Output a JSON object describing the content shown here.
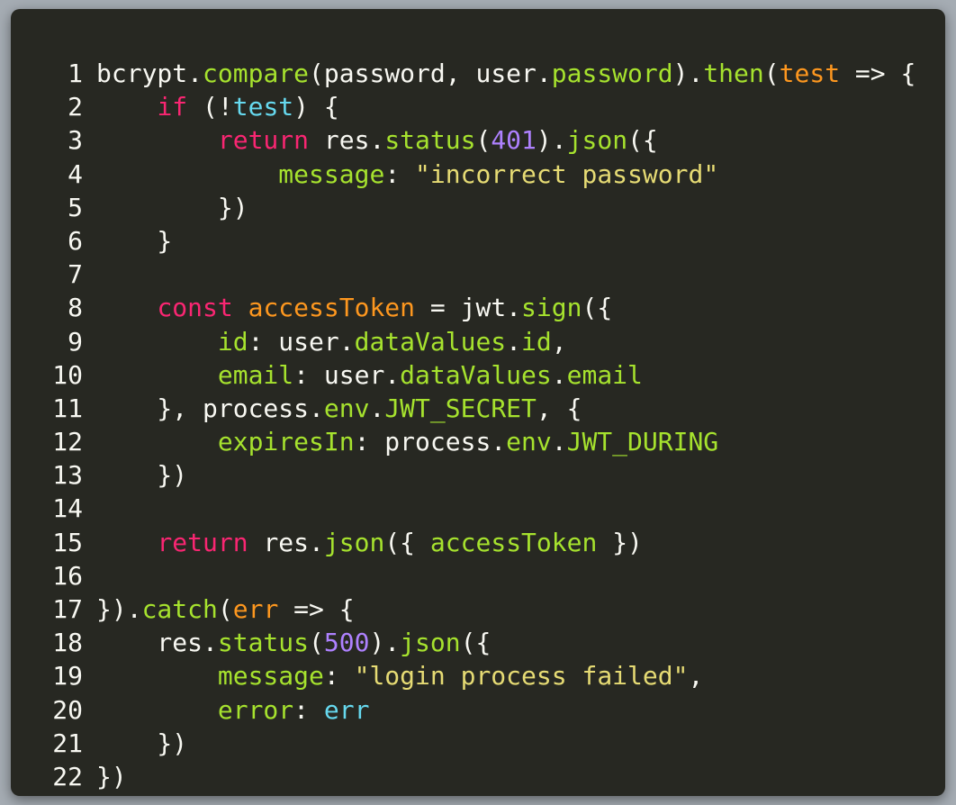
{
  "colors": {
    "default": "#f8f8f2",
    "keyword": "#f92672",
    "function": "#a6e22e",
    "param": "#fd971f",
    "number": "#ae81ff",
    "string": "#e6db74",
    "builtin": "#66d9ef",
    "background": "#272822"
  },
  "code": {
    "language": "javascript",
    "lines": [
      {
        "n": "1",
        "tokens": [
          [
            "bcrypt.",
            "d"
          ],
          [
            "compare",
            "f"
          ],
          [
            "(password, user.",
            "d"
          ],
          [
            "password",
            "f"
          ],
          [
            ").",
            "d"
          ],
          [
            "then",
            "f"
          ],
          [
            "(",
            "d"
          ],
          [
            "test",
            "p"
          ],
          [
            " => {",
            "d"
          ]
        ]
      },
      {
        "n": "2",
        "tokens": [
          [
            "    ",
            "d"
          ],
          [
            "if",
            "k"
          ],
          [
            " (!",
            "d"
          ],
          [
            "test",
            "b"
          ],
          [
            ") {",
            "d"
          ]
        ]
      },
      {
        "n": "3",
        "tokens": [
          [
            "        ",
            "d"
          ],
          [
            "return",
            "k"
          ],
          [
            " res.",
            "d"
          ],
          [
            "status",
            "f"
          ],
          [
            "(",
            "d"
          ],
          [
            "401",
            "n"
          ],
          [
            ").",
            "d"
          ],
          [
            "json",
            "f"
          ],
          [
            "({",
            "d"
          ]
        ]
      },
      {
        "n": "4",
        "tokens": [
          [
            "            ",
            "d"
          ],
          [
            "message",
            "f"
          ],
          [
            ": ",
            "d"
          ],
          [
            "\"incorrect password\"",
            "s"
          ]
        ]
      },
      {
        "n": "5",
        "tokens": [
          [
            "        })",
            "d"
          ]
        ]
      },
      {
        "n": "6",
        "tokens": [
          [
            "    }",
            "d"
          ]
        ]
      },
      {
        "n": "7",
        "tokens": []
      },
      {
        "n": "8",
        "tokens": [
          [
            "    ",
            "d"
          ],
          [
            "const",
            "k"
          ],
          [
            " ",
            "d"
          ],
          [
            "accessToken",
            "p"
          ],
          [
            " = jwt.",
            "d"
          ],
          [
            "sign",
            "f"
          ],
          [
            "({",
            "d"
          ]
        ]
      },
      {
        "n": "9",
        "tokens": [
          [
            "        ",
            "d"
          ],
          [
            "id",
            "f"
          ],
          [
            ": user.",
            "d"
          ],
          [
            "dataValues",
            "f"
          ],
          [
            ".",
            "d"
          ],
          [
            "id",
            "f"
          ],
          [
            ",",
            "d"
          ]
        ]
      },
      {
        "n": "10",
        "tokens": [
          [
            "        ",
            "d"
          ],
          [
            "email",
            "f"
          ],
          [
            ": user.",
            "d"
          ],
          [
            "dataValues",
            "f"
          ],
          [
            ".",
            "d"
          ],
          [
            "email",
            "f"
          ]
        ]
      },
      {
        "n": "11",
        "tokens": [
          [
            "    }, process.",
            "d"
          ],
          [
            "env",
            "f"
          ],
          [
            ".",
            "d"
          ],
          [
            "JWT_SECRET",
            "f"
          ],
          [
            ", {",
            "d"
          ]
        ]
      },
      {
        "n": "12",
        "tokens": [
          [
            "        ",
            "d"
          ],
          [
            "expiresIn",
            "f"
          ],
          [
            ": process.",
            "d"
          ],
          [
            "env",
            "f"
          ],
          [
            ".",
            "d"
          ],
          [
            "JWT_DURING",
            "f"
          ]
        ]
      },
      {
        "n": "13",
        "tokens": [
          [
            "    })",
            "d"
          ]
        ]
      },
      {
        "n": "14",
        "tokens": []
      },
      {
        "n": "15",
        "tokens": [
          [
            "    ",
            "d"
          ],
          [
            "return",
            "k"
          ],
          [
            " res.",
            "d"
          ],
          [
            "json",
            "f"
          ],
          [
            "({ ",
            "d"
          ],
          [
            "accessToken",
            "f"
          ],
          [
            " })",
            "d"
          ]
        ]
      },
      {
        "n": "16",
        "tokens": []
      },
      {
        "n": "17",
        "tokens": [
          [
            "}).",
            "d"
          ],
          [
            "catch",
            "f"
          ],
          [
            "(",
            "d"
          ],
          [
            "err",
            "p"
          ],
          [
            " => {",
            "d"
          ]
        ]
      },
      {
        "n": "18",
        "tokens": [
          [
            "    res.",
            "d"
          ],
          [
            "status",
            "f"
          ],
          [
            "(",
            "d"
          ],
          [
            "500",
            "n"
          ],
          [
            ").",
            "d"
          ],
          [
            "json",
            "f"
          ],
          [
            "({",
            "d"
          ]
        ]
      },
      {
        "n": "19",
        "tokens": [
          [
            "        ",
            "d"
          ],
          [
            "message",
            "f"
          ],
          [
            ": ",
            "d"
          ],
          [
            "\"login process failed\"",
            "s"
          ],
          [
            ",",
            "d"
          ]
        ]
      },
      {
        "n": "20",
        "tokens": [
          [
            "        ",
            "d"
          ],
          [
            "error",
            "f"
          ],
          [
            ": ",
            "d"
          ],
          [
            "err",
            "b"
          ]
        ]
      },
      {
        "n": "21",
        "tokens": [
          [
            "    })",
            "d"
          ]
        ]
      },
      {
        "n": "22",
        "tokens": [
          [
            "})",
            "d"
          ]
        ]
      }
    ]
  }
}
